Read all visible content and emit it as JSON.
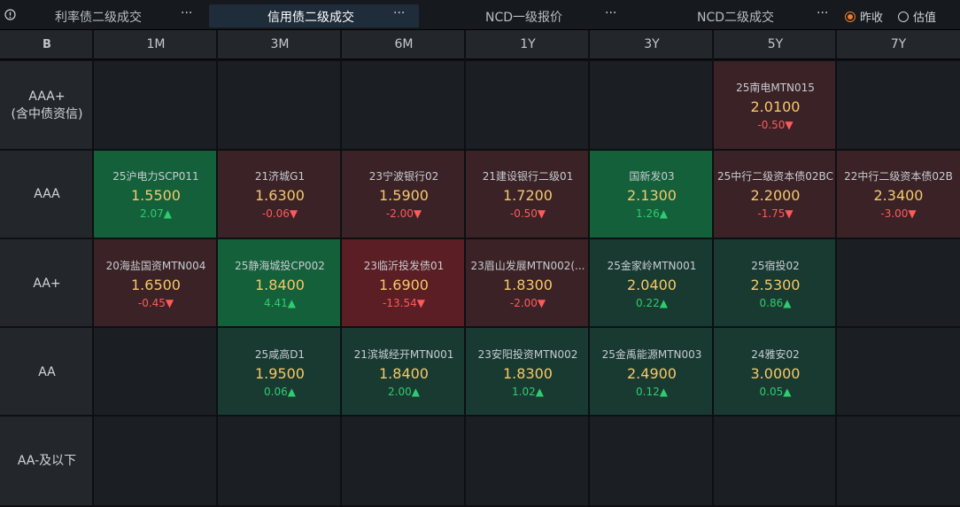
{
  "tabs": [
    {
      "label": "利率债二级成交",
      "more": "···",
      "active": false
    },
    {
      "label": "信用债二级成交",
      "more": "···",
      "active": true
    },
    {
      "label": "NCD一级报价",
      "more": "···",
      "active": false
    },
    {
      "label": "NCD二级成交",
      "more": "···",
      "active": false
    }
  ],
  "info_icon": "info-circle-icon",
  "radios": [
    {
      "label": "昨收",
      "checked": true
    },
    {
      "label": "估值",
      "checked": false
    }
  ],
  "corner_icon_label": "B",
  "columns": [
    "1M",
    "3M",
    "6M",
    "1Y",
    "3Y",
    "5Y",
    "7Y"
  ],
  "rows": [
    {
      "label_line1": "AAA+",
      "label_line2": "(含中债资信)"
    },
    {
      "label_line1": "AAA",
      "label_line2": ""
    },
    {
      "label_line1": "AA+",
      "label_line2": ""
    },
    {
      "label_line1": "AA",
      "label_line2": ""
    },
    {
      "label_line1": "AA-及以下",
      "label_line2": ""
    }
  ],
  "colors": {
    "positive": "#2ecc71",
    "negative": "#ff5a5a",
    "yield": "#f7c96a",
    "accent": "#f07c2c"
  },
  "cells": [
    [
      null,
      null,
      null,
      null,
      null,
      {
        "name": "25南电MTN015",
        "yield": "2.0100",
        "change": "-0.50▼",
        "dir": "down",
        "tone": "neg"
      },
      null
    ],
    [
      {
        "name": "25沪电力SCP011",
        "yield": "1.5500",
        "change": "2.07▲",
        "dir": "up",
        "tone": "pos-strong"
      },
      {
        "name": "21济城G1",
        "yield": "1.6300",
        "change": "-0.06▼",
        "dir": "down",
        "tone": "neg"
      },
      {
        "name": "23宁波银行02",
        "yield": "1.5900",
        "change": "-2.00▼",
        "dir": "down",
        "tone": "neg"
      },
      {
        "name": "21建设银行二级01",
        "yield": "1.7200",
        "change": "-0.50▼",
        "dir": "down",
        "tone": "neg"
      },
      {
        "name": "国新发03",
        "yield": "2.1300",
        "change": "1.26▲",
        "dir": "up",
        "tone": "pos-strong"
      },
      {
        "name": "25中行二级资本债02BC",
        "yield": "2.2000",
        "change": "-1.75▼",
        "dir": "down",
        "tone": "neg"
      },
      {
        "name": "22中行二级资本债02B",
        "yield": "2.3400",
        "change": "-3.00▼",
        "dir": "down",
        "tone": "neg"
      }
    ],
    [
      {
        "name": "20海盐国资MTN004",
        "yield": "1.6500",
        "change": "-0.45▼",
        "dir": "down",
        "tone": "neg"
      },
      {
        "name": "25静海城投CP002",
        "yield": "1.8400",
        "change": "4.41▲",
        "dir": "up",
        "tone": "pos-strong"
      },
      {
        "name": "23临沂投发债01",
        "yield": "1.6900",
        "change": "-13.54▼",
        "dir": "down",
        "tone": "neg-strong"
      },
      {
        "name": "23眉山发展MTN002(...",
        "yield": "1.8300",
        "change": "-2.00▼",
        "dir": "down",
        "tone": "neg"
      },
      {
        "name": "25金家岭MTN001",
        "yield": "2.0400",
        "change": "0.22▲",
        "dir": "up",
        "tone": "pos"
      },
      {
        "name": "25宿投02",
        "yield": "2.5300",
        "change": "0.86▲",
        "dir": "up",
        "tone": "pos"
      },
      null
    ],
    [
      null,
      {
        "name": "25咸高D1",
        "yield": "1.9500",
        "change": "0.06▲",
        "dir": "up",
        "tone": "pos"
      },
      {
        "name": "21滨城经开MTN001",
        "yield": "1.8400",
        "change": "2.00▲",
        "dir": "up",
        "tone": "pos"
      },
      {
        "name": "23安阳投资MTN002",
        "yield": "1.8300",
        "change": "1.02▲",
        "dir": "up",
        "tone": "pos"
      },
      {
        "name": "25金禹能源MTN003",
        "yield": "2.4900",
        "change": "0.12▲",
        "dir": "up",
        "tone": "pos"
      },
      {
        "name": "24雅安02",
        "yield": "3.0000",
        "change": "0.05▲",
        "dir": "up",
        "tone": "pos"
      },
      null
    ],
    [
      null,
      null,
      null,
      null,
      null,
      null,
      null
    ]
  ]
}
